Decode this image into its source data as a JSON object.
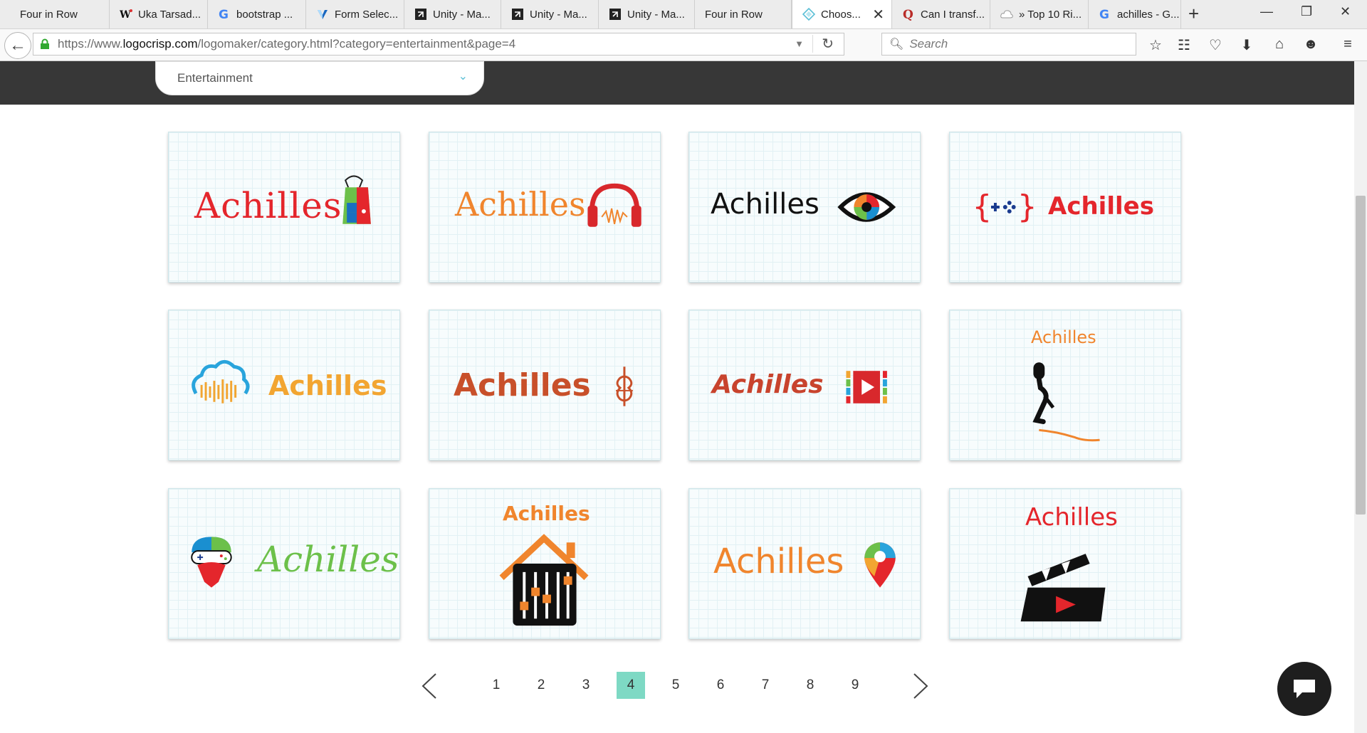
{
  "tabs": [
    {
      "label": "Four in Row",
      "icon": "none"
    },
    {
      "label": "Uka Tarsad...",
      "icon": "wiki-icon"
    },
    {
      "label": "bootstrap ...",
      "icon": "google-icon"
    },
    {
      "label": "Form Selec...",
      "icon": "vuetify-icon"
    },
    {
      "label": "Unity - Ma...",
      "icon": "unity-icon"
    },
    {
      "label": "Unity - Ma...",
      "icon": "unity-icon"
    },
    {
      "label": "Unity - Ma...",
      "icon": "unity-icon"
    },
    {
      "label": "Four in Row",
      "icon": "none"
    },
    {
      "label": "Choos...",
      "icon": "logocrisp-icon"
    },
    {
      "label": "Can I transf...",
      "icon": "quora-icon"
    },
    {
      "label": "» Top 10 Ri...",
      "icon": "cloud-icon"
    },
    {
      "label": "achilles - G...",
      "icon": "google-icon"
    }
  ],
  "nav": {
    "url_prefix": "https://www.",
    "url_domain": "logocrisp.com",
    "url_path": "/logomaker/category.html?category=entertainment&page=4",
    "search_placeholder": "Search"
  },
  "category": {
    "selected": "Entertainment"
  },
  "logos": [
    {
      "name": "Achilles",
      "color": "#e4262c"
    },
    {
      "name": "Achilles",
      "color": "#f0852d"
    },
    {
      "name": "Achilles",
      "color": "#111111"
    },
    {
      "name": "Achilles",
      "color": "#e4262c"
    },
    {
      "name": "Achilles",
      "color": "#f2a531"
    },
    {
      "name": "Achilles",
      "color": "#c8502a"
    },
    {
      "name": "Achilles",
      "color": "#c8432d"
    },
    {
      "name": "Achilles",
      "color": "#f0852d"
    },
    {
      "name": "Achilles",
      "color": "#6cc04a"
    },
    {
      "name": "Achilles",
      "color": "#f0852d"
    },
    {
      "name": "Achilles",
      "color": "#f0852d"
    },
    {
      "name": "Achilles",
      "color": "#e4262c"
    }
  ],
  "pagination": {
    "pages": [
      "1",
      "2",
      "3",
      "4",
      "5",
      "6",
      "7",
      "8",
      "9"
    ],
    "current": "4",
    "prev_icon": "chevron-left-icon",
    "next_icon": "chevron-right-icon"
  },
  "colors": {
    "accent": "#7ed9c4",
    "header_band": "#373737",
    "select_chevron": "#5bbfd6"
  }
}
